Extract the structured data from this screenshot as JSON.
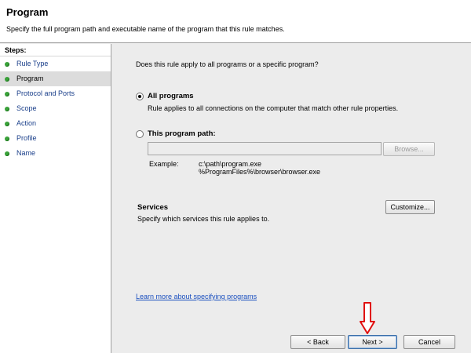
{
  "header": {
    "title": "Program",
    "subtitle": "Specify the full program path and executable name of the program that this rule matches."
  },
  "steps": {
    "title": "Steps:",
    "items": [
      {
        "label": "Rule Type"
      },
      {
        "label": "Program"
      },
      {
        "label": "Protocol and Ports"
      },
      {
        "label": "Scope"
      },
      {
        "label": "Action"
      },
      {
        "label": "Profile"
      },
      {
        "label": "Name"
      }
    ],
    "current": "Program"
  },
  "main": {
    "question": "Does this rule apply to all programs or a specific program?",
    "all_programs": {
      "label": "All programs",
      "description": "Rule applies to all connections on the computer that match other rule properties.",
      "selected": true
    },
    "program_path": {
      "label": "This program path:",
      "value": "",
      "selected": false
    },
    "browse_label": "Browse...",
    "example_label": "Example:",
    "example_values": [
      "c:\\path\\program.exe",
      "%ProgramFiles%\\browser\\browser.exe"
    ],
    "services": {
      "title": "Services",
      "description": "Specify which services this rule applies to.",
      "customize_label": "Customize..."
    },
    "learn_more": "Learn more about specifying programs"
  },
  "footer": {
    "back_label": "< Back",
    "next_label": "Next >",
    "cancel_label": "Cancel"
  },
  "icons": {
    "step_dot": "green-dot-icon",
    "annotation": "red-down-arrow-icon"
  },
  "colors": {
    "step_dot": "#3aa23a",
    "link": "#1a4fbf",
    "arrow": "#e01010"
  }
}
